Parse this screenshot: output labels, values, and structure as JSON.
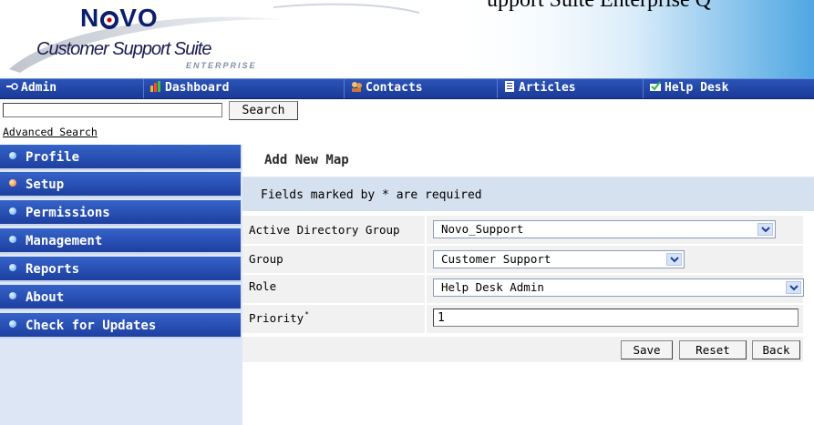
{
  "header": {
    "logo_text_left": "N",
    "logo_text_right": "VO",
    "logo_subtitle": "Customer Support Suite",
    "logo_edition": "ENTERPRISE",
    "clipped_text": "upport Suite Enterprise Q"
  },
  "nav": {
    "items": [
      {
        "label": "Admin",
        "icon": "key-icon"
      },
      {
        "label": "Dashboard",
        "icon": "chart-icon"
      },
      {
        "label": "Contacts",
        "icon": "contacts-icon"
      },
      {
        "label": "Articles",
        "icon": "articles-icon"
      },
      {
        "label": "Help Desk",
        "icon": "helpdesk-icon"
      }
    ]
  },
  "search": {
    "value": "",
    "button_label": "Search",
    "advanced_label": "Advanced Search"
  },
  "sidebar": {
    "items": [
      {
        "label": "Profile",
        "active": false
      },
      {
        "label": "Setup",
        "active": true
      },
      {
        "label": "Permissions",
        "active": false
      },
      {
        "label": "Management",
        "active": false
      },
      {
        "label": "Reports",
        "active": false
      },
      {
        "label": "About",
        "active": false
      },
      {
        "label": "Check for Updates",
        "active": false
      }
    ]
  },
  "content": {
    "title": "Add New Map",
    "required_note": "Fields marked by * are required",
    "fields": {
      "ad_group": {
        "label": "Active Directory Group",
        "value": "Novo_Support"
      },
      "group": {
        "label": "Group",
        "value": "Customer Support"
      },
      "role": {
        "label": "Role",
        "value": "Help Desk Admin"
      },
      "priority": {
        "label": "Priority",
        "required_mark": "*",
        "value": "1"
      }
    },
    "buttons": {
      "save": "Save",
      "reset": "Reset",
      "back": "Back"
    }
  },
  "colors": {
    "nav_bg": "#1f43a8",
    "sidebar_bg": "#2a52b8",
    "note_bg": "#d6e1ef",
    "active_bullet": "#f07a1a"
  }
}
